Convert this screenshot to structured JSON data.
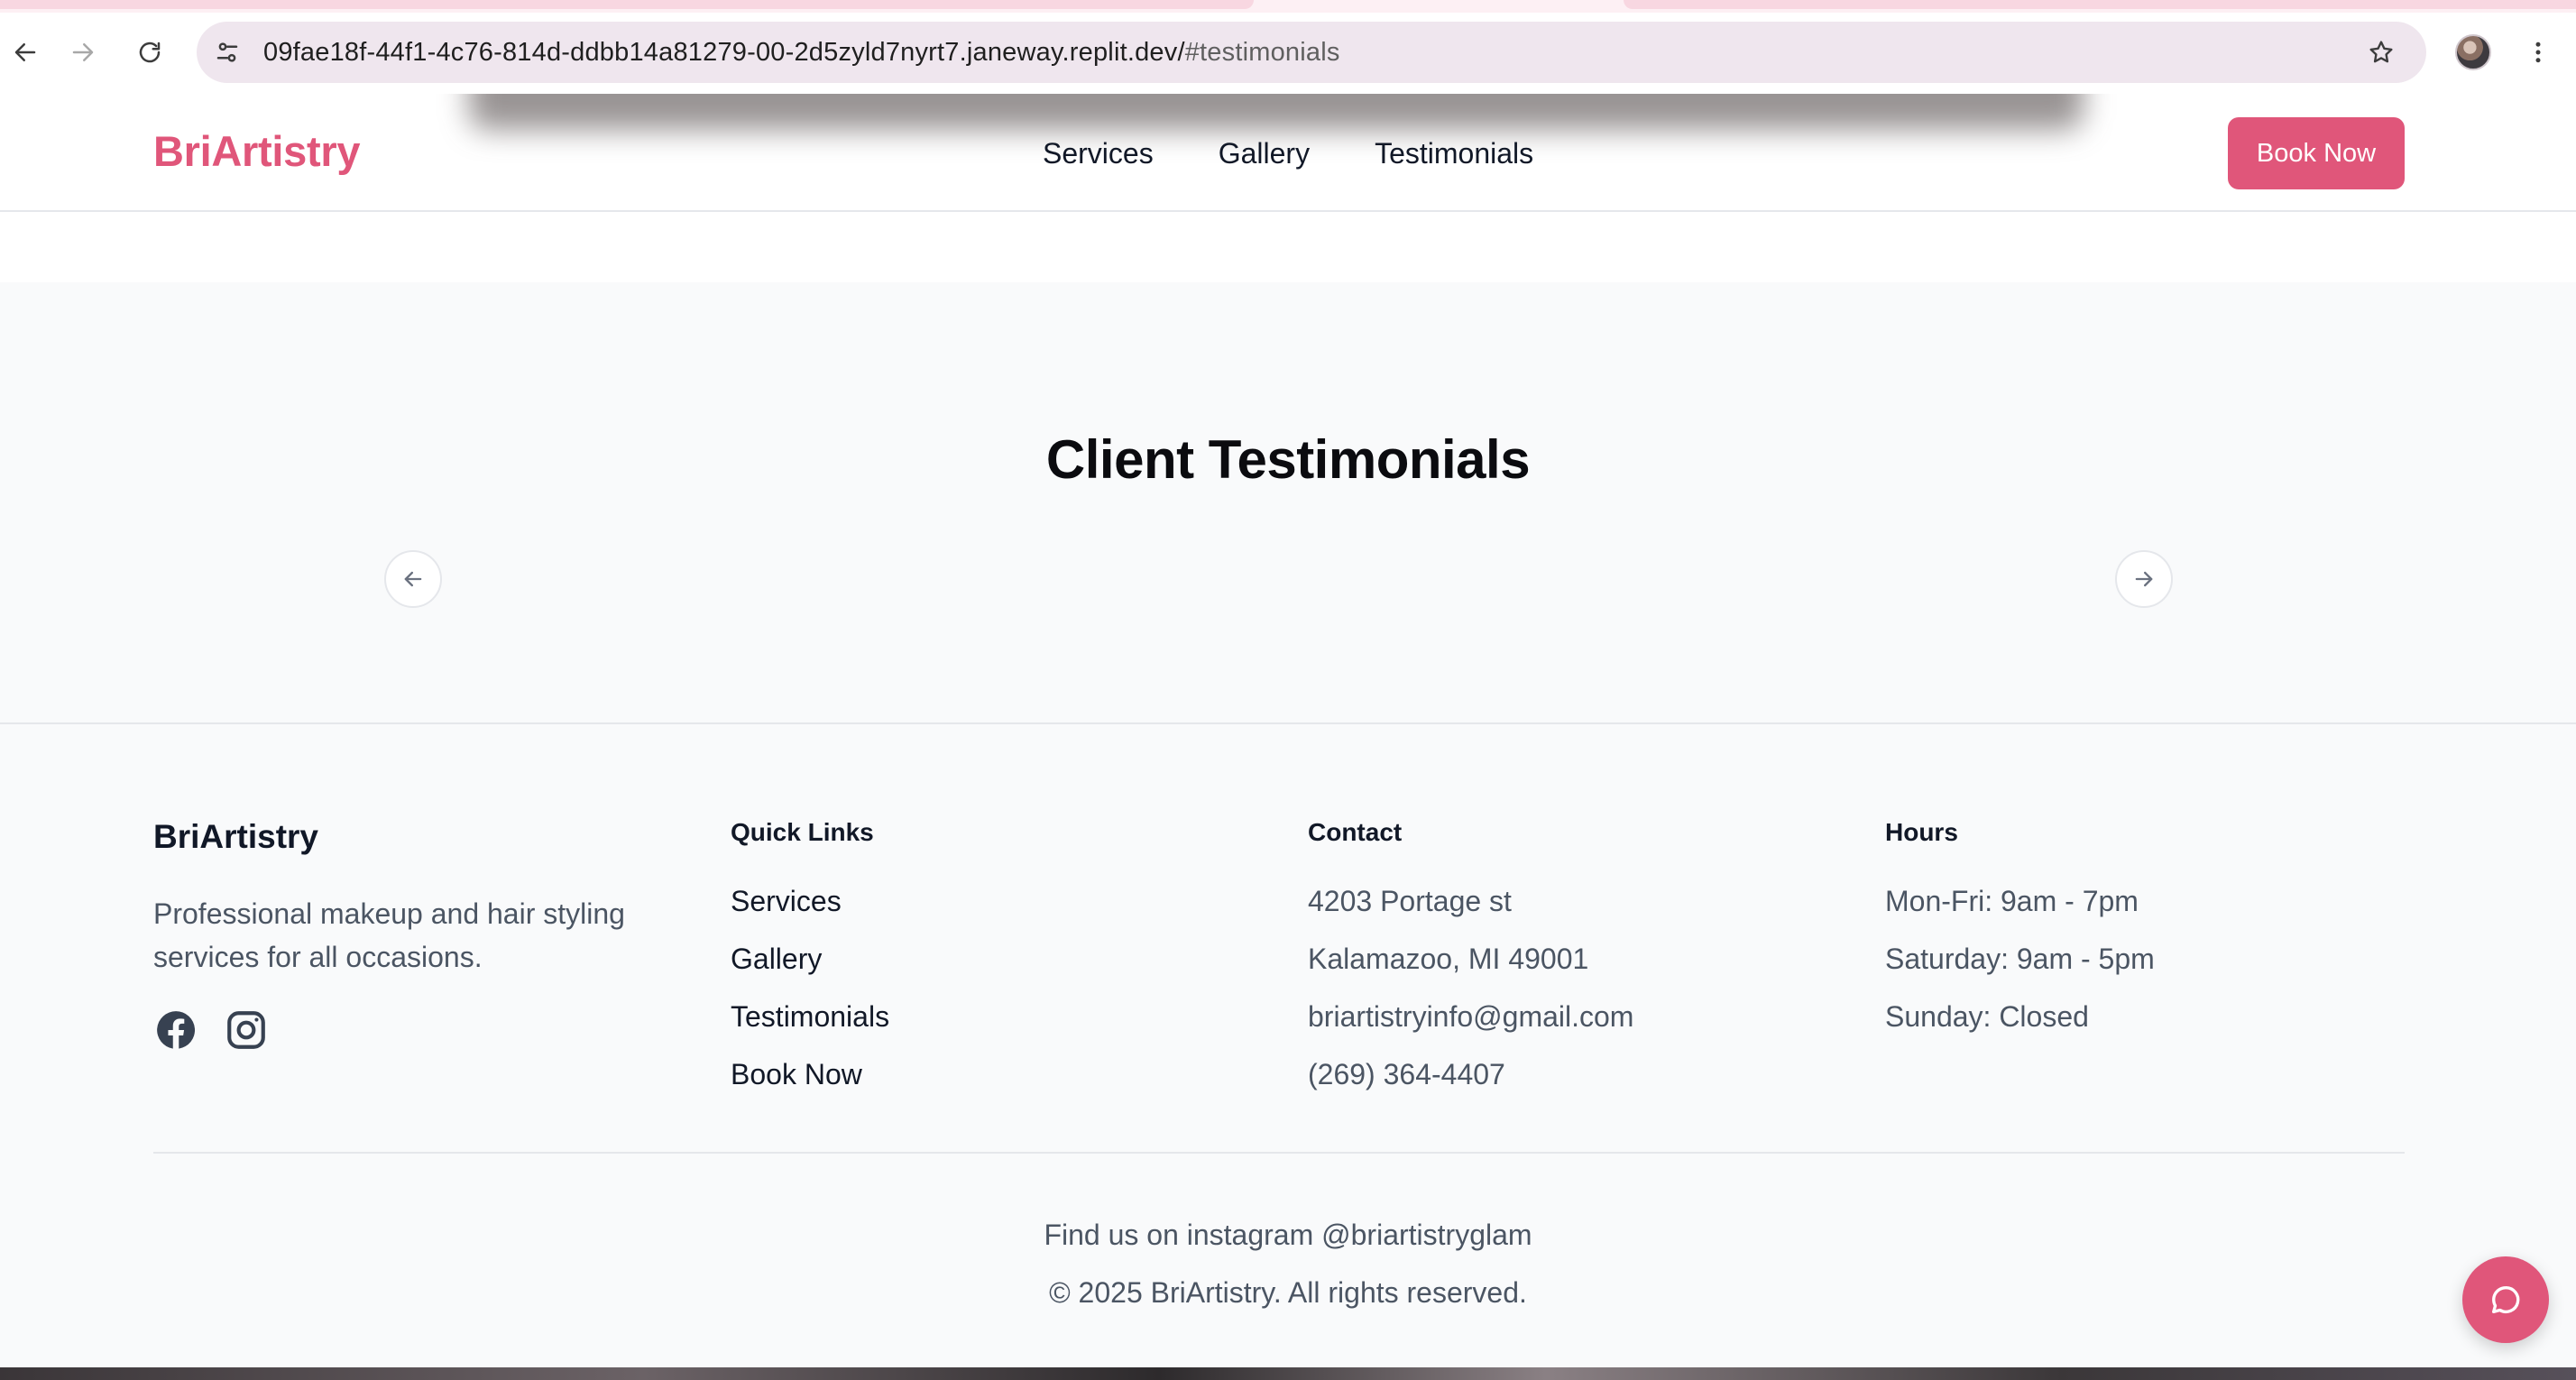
{
  "browser": {
    "url_main": "09fae18f-44f1-4c76-814d-ddbb14a81279-00-2d5zyld7nyrt7.janeway.replit.dev/",
    "url_hash": "#testimonials",
    "icons": {
      "back": "arrow-left-icon",
      "forward": "arrow-right-icon",
      "reload": "reload-icon",
      "site_info": "tune-icon",
      "bookmark": "star-icon",
      "menu": "more-vertical-icon"
    }
  },
  "header": {
    "logo": "BriArtistry",
    "nav": [
      "Services",
      "Gallery",
      "Testimonials"
    ],
    "cta": "Book Now"
  },
  "testimonials": {
    "title": "Client Testimonials",
    "prev_icon": "arrow-left-icon",
    "next_icon": "arrow-right-icon"
  },
  "footer": {
    "brand": "BriArtistry",
    "description": "Professional makeup and hair styling services for all occasions.",
    "social": [
      "facebook-icon",
      "instagram-icon"
    ],
    "quick_links": {
      "heading": "Quick Links",
      "items": [
        "Services",
        "Gallery",
        "Testimonials",
        "Book Now"
      ]
    },
    "contact": {
      "heading": "Contact",
      "items": [
        "4203 Portage st",
        "Kalamazoo, MI 49001",
        "briartistryinfo@gmail.com",
        "(269) 364-4407"
      ]
    },
    "hours": {
      "heading": "Hours",
      "items": [
        "Mon-Fri: 9am - 7pm",
        "Saturday: 9am - 5pm",
        "Sunday: Closed"
      ]
    },
    "instagram_line": "Find us on instagram @briartistryglam",
    "copyright": "© 2025 BriArtistry. All rights reserved."
  },
  "chat": {
    "icon": "chat-bubble-icon"
  },
  "colors": {
    "brand": "#e0567a",
    "section_bg": "#f9fafb",
    "omnibox_bg": "#efe6ee"
  }
}
